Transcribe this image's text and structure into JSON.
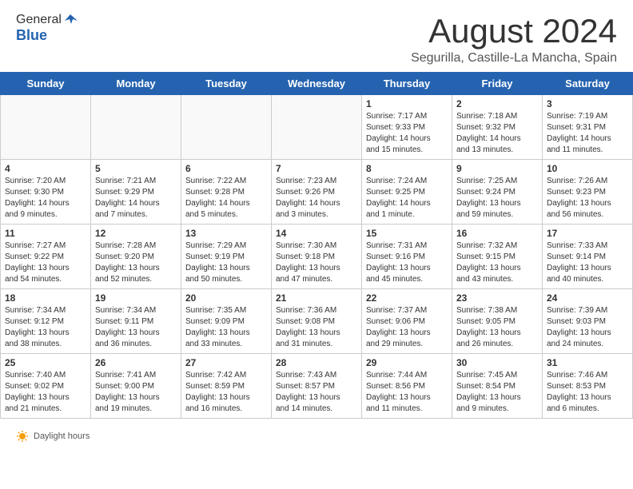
{
  "header": {
    "logo_general": "General",
    "logo_blue": "Blue",
    "month_year": "August 2024",
    "location": "Segurilla, Castille-La Mancha, Spain"
  },
  "days_of_week": [
    "Sunday",
    "Monday",
    "Tuesday",
    "Wednesday",
    "Thursday",
    "Friday",
    "Saturday"
  ],
  "weeks": [
    [
      {
        "day": "",
        "info": ""
      },
      {
        "day": "",
        "info": ""
      },
      {
        "day": "",
        "info": ""
      },
      {
        "day": "",
        "info": ""
      },
      {
        "day": "1",
        "info": "Sunrise: 7:17 AM\nSunset: 9:33 PM\nDaylight: 14 hours\nand 15 minutes."
      },
      {
        "day": "2",
        "info": "Sunrise: 7:18 AM\nSunset: 9:32 PM\nDaylight: 14 hours\nand 13 minutes."
      },
      {
        "day": "3",
        "info": "Sunrise: 7:19 AM\nSunset: 9:31 PM\nDaylight: 14 hours\nand 11 minutes."
      }
    ],
    [
      {
        "day": "4",
        "info": "Sunrise: 7:20 AM\nSunset: 9:30 PM\nDaylight: 14 hours\nand 9 minutes."
      },
      {
        "day": "5",
        "info": "Sunrise: 7:21 AM\nSunset: 9:29 PM\nDaylight: 14 hours\nand 7 minutes."
      },
      {
        "day": "6",
        "info": "Sunrise: 7:22 AM\nSunset: 9:28 PM\nDaylight: 14 hours\nand 5 minutes."
      },
      {
        "day": "7",
        "info": "Sunrise: 7:23 AM\nSunset: 9:26 PM\nDaylight: 14 hours\nand 3 minutes."
      },
      {
        "day": "8",
        "info": "Sunrise: 7:24 AM\nSunset: 9:25 PM\nDaylight: 14 hours\nand 1 minute."
      },
      {
        "day": "9",
        "info": "Sunrise: 7:25 AM\nSunset: 9:24 PM\nDaylight: 13 hours\nand 59 minutes."
      },
      {
        "day": "10",
        "info": "Sunrise: 7:26 AM\nSunset: 9:23 PM\nDaylight: 13 hours\nand 56 minutes."
      }
    ],
    [
      {
        "day": "11",
        "info": "Sunrise: 7:27 AM\nSunset: 9:22 PM\nDaylight: 13 hours\nand 54 minutes."
      },
      {
        "day": "12",
        "info": "Sunrise: 7:28 AM\nSunset: 9:20 PM\nDaylight: 13 hours\nand 52 minutes."
      },
      {
        "day": "13",
        "info": "Sunrise: 7:29 AM\nSunset: 9:19 PM\nDaylight: 13 hours\nand 50 minutes."
      },
      {
        "day": "14",
        "info": "Sunrise: 7:30 AM\nSunset: 9:18 PM\nDaylight: 13 hours\nand 47 minutes."
      },
      {
        "day": "15",
        "info": "Sunrise: 7:31 AM\nSunset: 9:16 PM\nDaylight: 13 hours\nand 45 minutes."
      },
      {
        "day": "16",
        "info": "Sunrise: 7:32 AM\nSunset: 9:15 PM\nDaylight: 13 hours\nand 43 minutes."
      },
      {
        "day": "17",
        "info": "Sunrise: 7:33 AM\nSunset: 9:14 PM\nDaylight: 13 hours\nand 40 minutes."
      }
    ],
    [
      {
        "day": "18",
        "info": "Sunrise: 7:34 AM\nSunset: 9:12 PM\nDaylight: 13 hours\nand 38 minutes."
      },
      {
        "day": "19",
        "info": "Sunrise: 7:34 AM\nSunset: 9:11 PM\nDaylight: 13 hours\nand 36 minutes."
      },
      {
        "day": "20",
        "info": "Sunrise: 7:35 AM\nSunset: 9:09 PM\nDaylight: 13 hours\nand 33 minutes."
      },
      {
        "day": "21",
        "info": "Sunrise: 7:36 AM\nSunset: 9:08 PM\nDaylight: 13 hours\nand 31 minutes."
      },
      {
        "day": "22",
        "info": "Sunrise: 7:37 AM\nSunset: 9:06 PM\nDaylight: 13 hours\nand 29 minutes."
      },
      {
        "day": "23",
        "info": "Sunrise: 7:38 AM\nSunset: 9:05 PM\nDaylight: 13 hours\nand 26 minutes."
      },
      {
        "day": "24",
        "info": "Sunrise: 7:39 AM\nSunset: 9:03 PM\nDaylight: 13 hours\nand 24 minutes."
      }
    ],
    [
      {
        "day": "25",
        "info": "Sunrise: 7:40 AM\nSunset: 9:02 PM\nDaylight: 13 hours\nand 21 minutes."
      },
      {
        "day": "26",
        "info": "Sunrise: 7:41 AM\nSunset: 9:00 PM\nDaylight: 13 hours\nand 19 minutes."
      },
      {
        "day": "27",
        "info": "Sunrise: 7:42 AM\nSunset: 8:59 PM\nDaylight: 13 hours\nand 16 minutes."
      },
      {
        "day": "28",
        "info": "Sunrise: 7:43 AM\nSunset: 8:57 PM\nDaylight: 13 hours\nand 14 minutes."
      },
      {
        "day": "29",
        "info": "Sunrise: 7:44 AM\nSunset: 8:56 PM\nDaylight: 13 hours\nand 11 minutes."
      },
      {
        "day": "30",
        "info": "Sunrise: 7:45 AM\nSunset: 8:54 PM\nDaylight: 13 hours\nand 9 minutes."
      },
      {
        "day": "31",
        "info": "Sunrise: 7:46 AM\nSunset: 8:53 PM\nDaylight: 13 hours\nand 6 minutes."
      }
    ]
  ],
  "footer": {
    "daylight_label": "Daylight hours"
  }
}
